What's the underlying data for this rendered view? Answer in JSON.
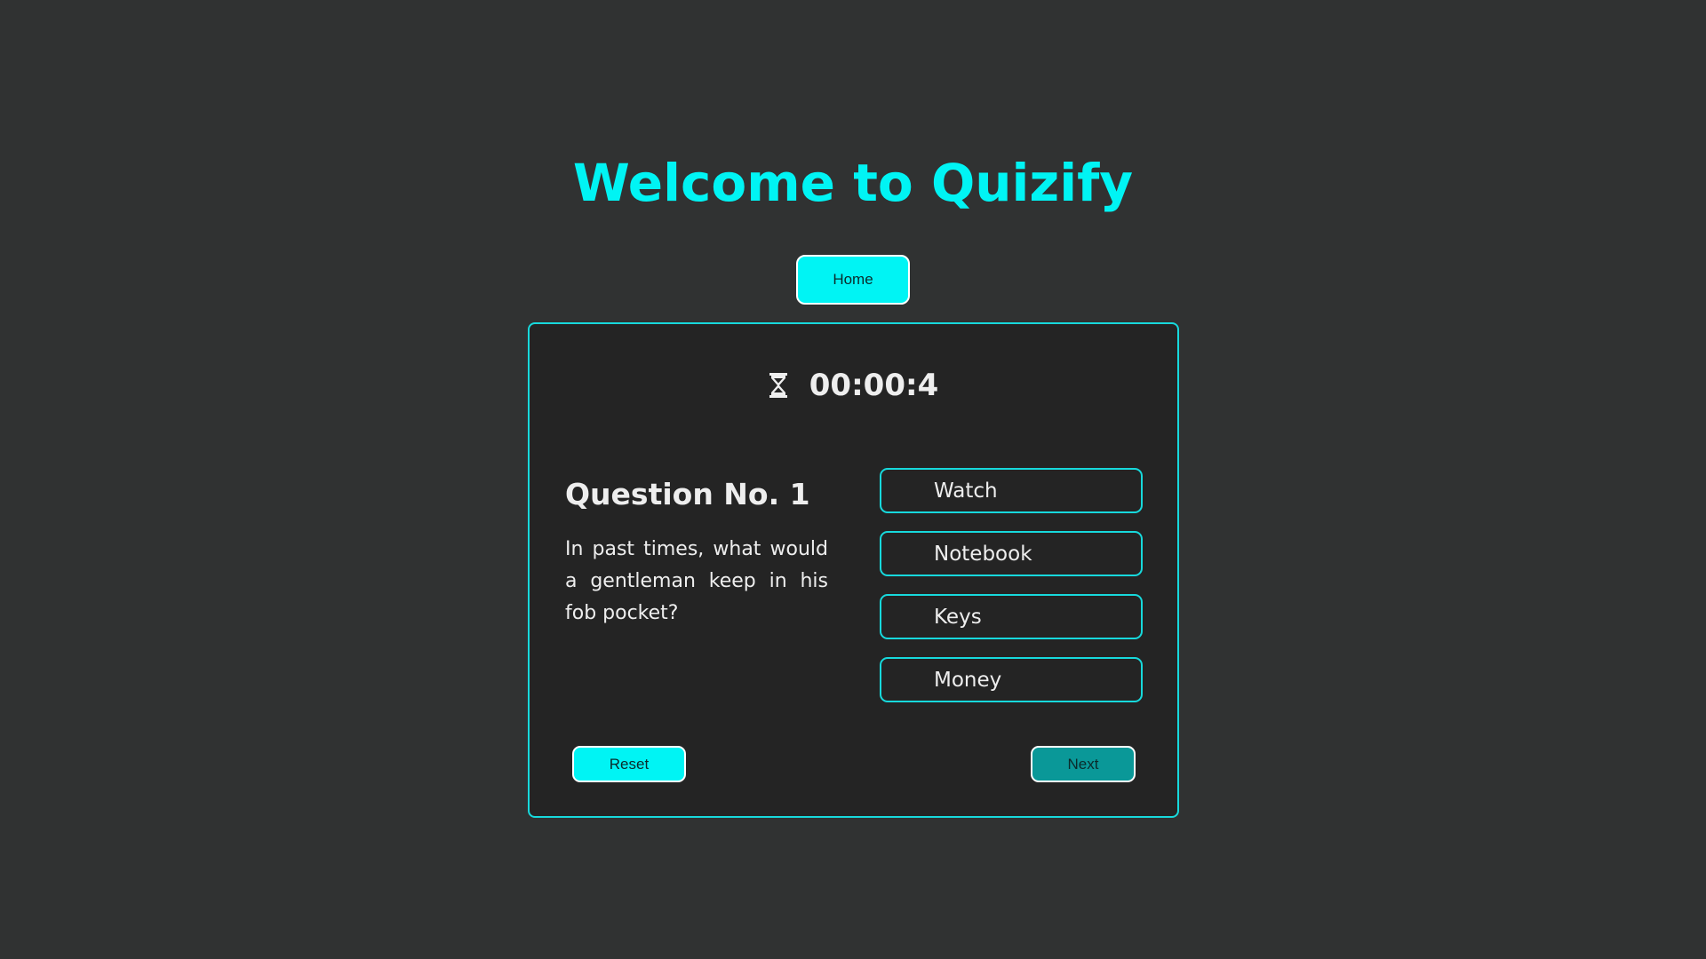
{
  "app": {
    "title": "Welcome to Quizify"
  },
  "nav": {
    "home_label": "Home"
  },
  "quiz": {
    "timer": {
      "icon": "hourglass-icon",
      "value": "00:00:4"
    },
    "question_title": "Question No. 1",
    "question_text": "In past times, what would a gentleman keep in his fob pocket?",
    "options": [
      {
        "label": "Watch"
      },
      {
        "label": "Notebook"
      },
      {
        "label": "Keys"
      },
      {
        "label": "Money"
      }
    ],
    "reset_label": "Reset",
    "next_label": "Next"
  },
  "colors": {
    "background": "#303232",
    "card_background": "#242424",
    "accent": "#00f4f4",
    "border_accent": "#17d9dc",
    "next_button": "#0a9898",
    "text": "#eeeeee"
  }
}
